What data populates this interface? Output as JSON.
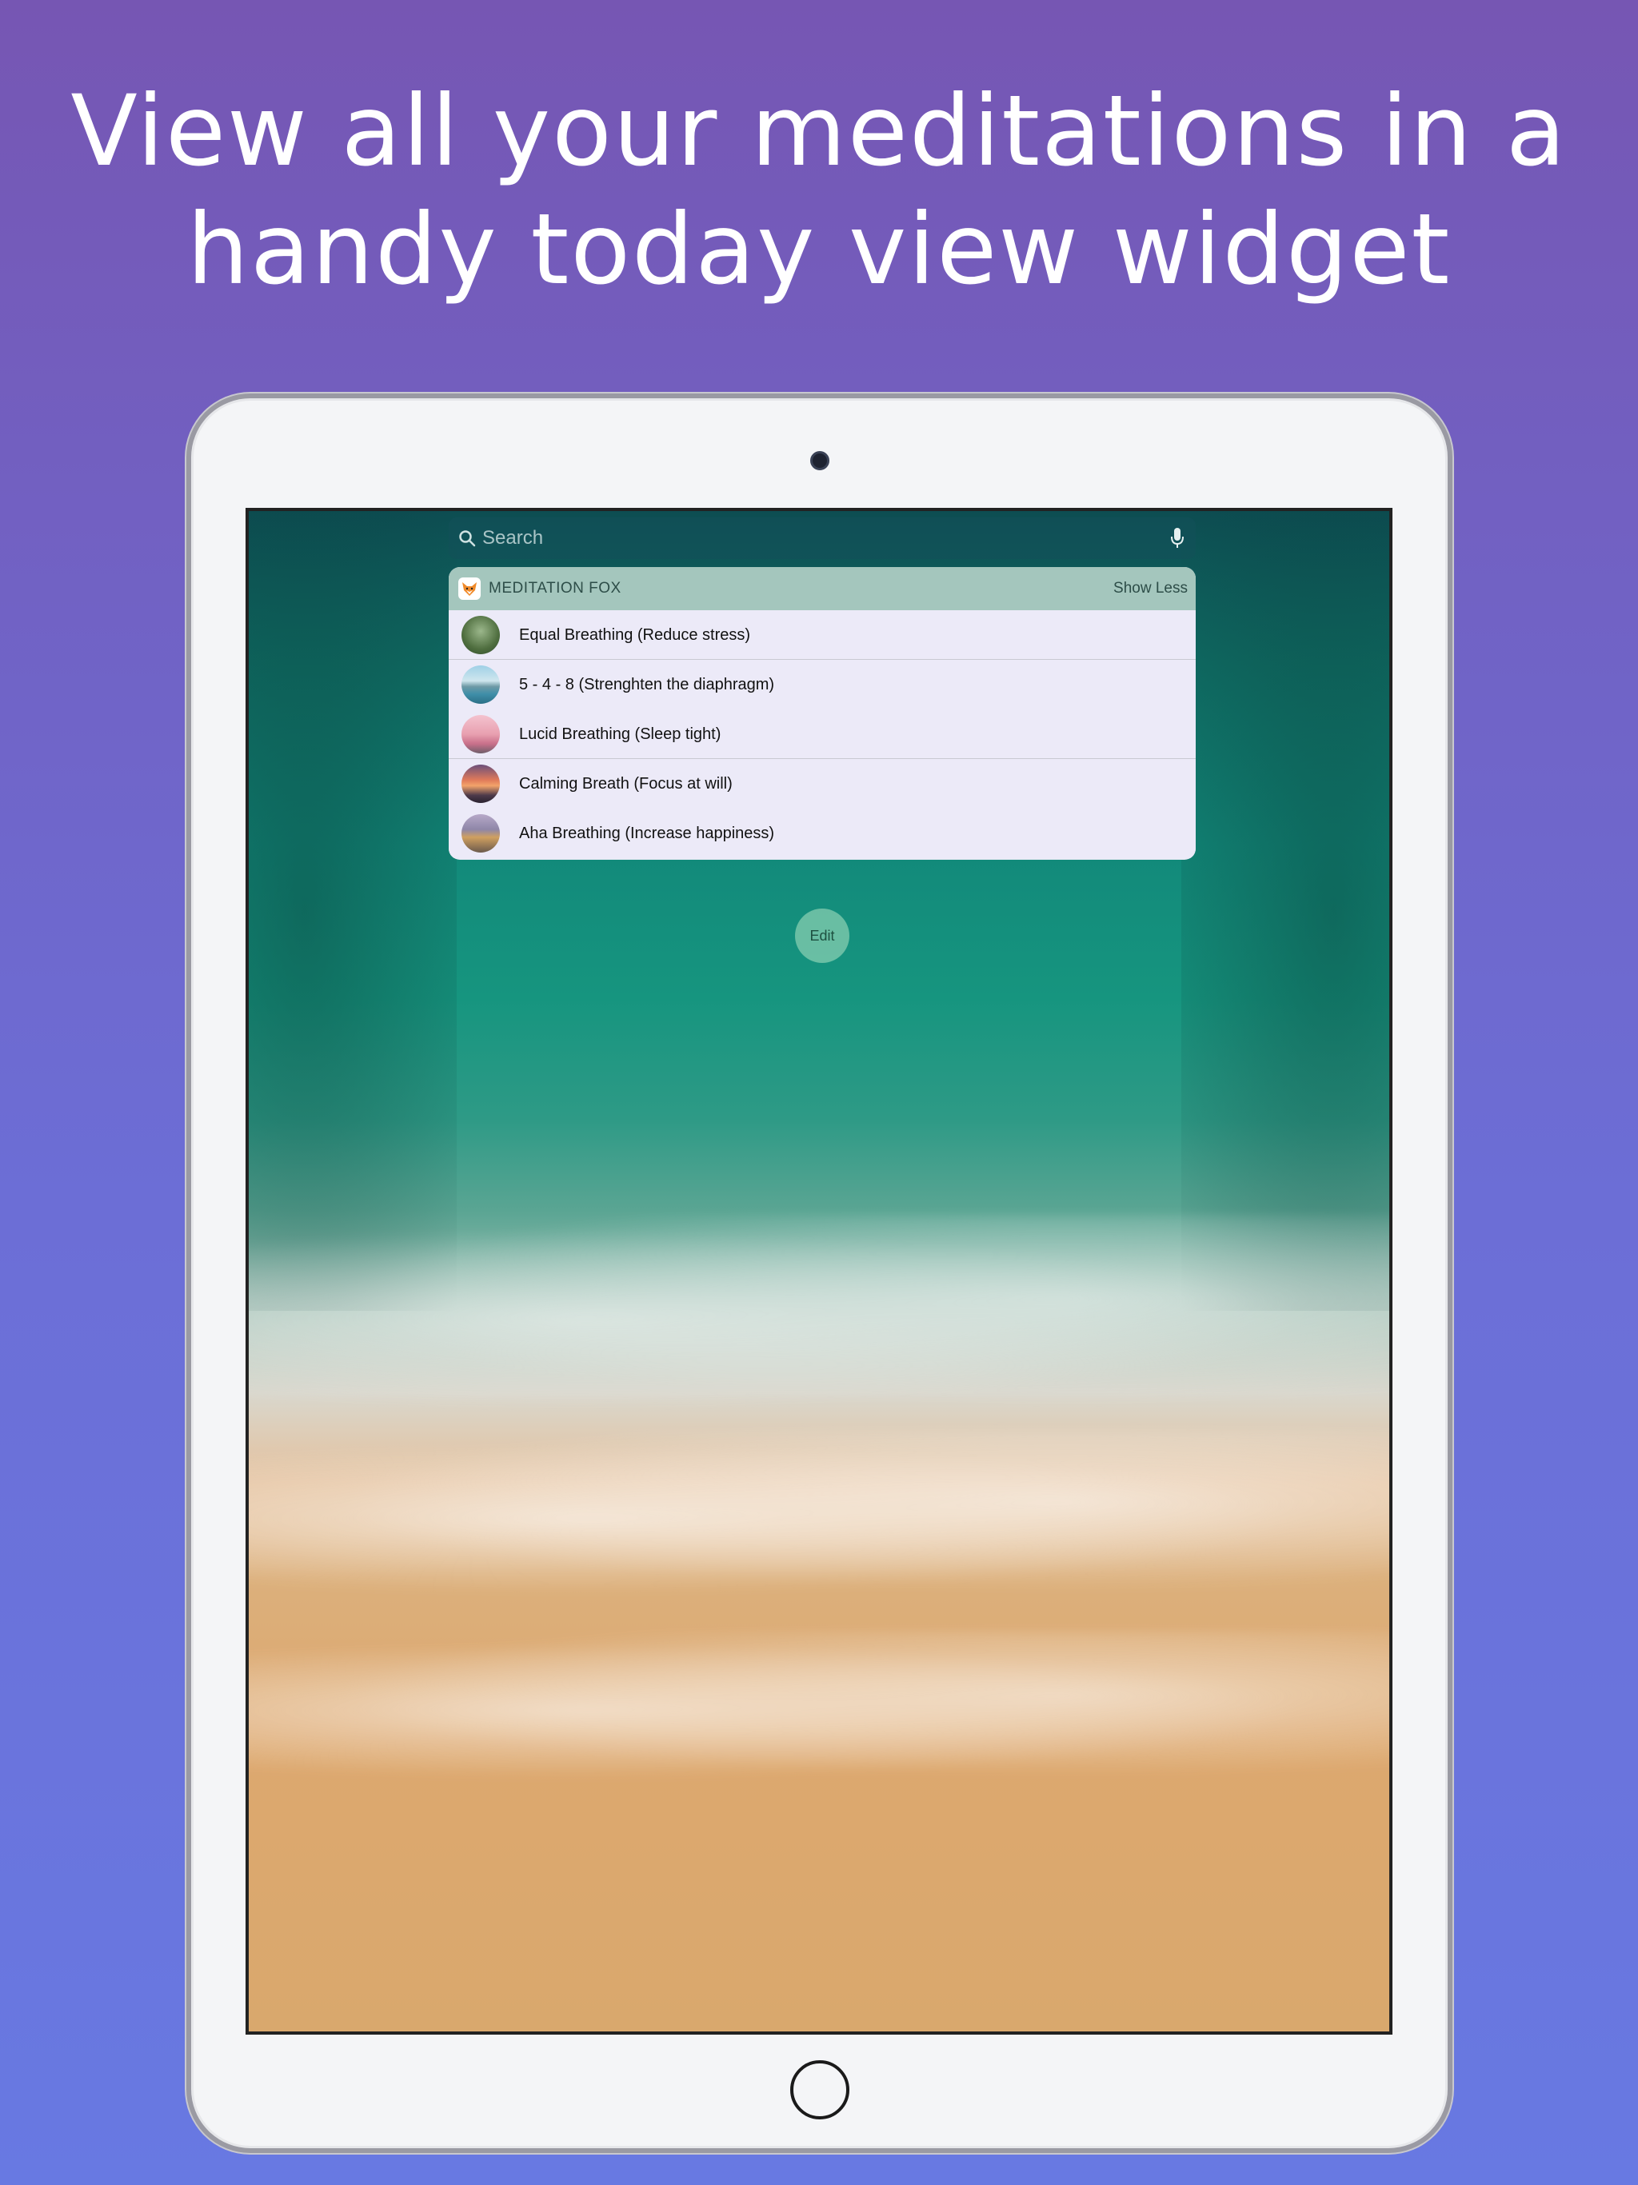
{
  "headline": {
    "line1": "View all your meditations in a",
    "line2": "handy today view widget"
  },
  "search": {
    "placeholder": "Search",
    "icon": "search-icon",
    "mic_icon": "microphone-icon"
  },
  "widget": {
    "app_name": "MEDITATION FOX",
    "app_icon": "fox-icon",
    "toggle_label": "Show Less",
    "items": [
      {
        "label": "Equal Breathing (Reduce stress)",
        "thumb": "forest"
      },
      {
        "label": "5 - 4 - 8 (Strenghten the diaphragm)",
        "thumb": "mountain-lake"
      },
      {
        "label": "Lucid Breathing (Sleep tight)",
        "thumb": "pink-sky"
      },
      {
        "label": "Calming Breath (Focus at will)",
        "thumb": "sunset"
      },
      {
        "label": "Aha Breathing (Increase happiness)",
        "thumb": "beach"
      }
    ]
  },
  "edit_label": "Edit",
  "colors": {
    "background_top": "#7656b3",
    "background_bottom": "#6879e2",
    "widget_header": "#a4c6bd",
    "widget_body": "#eaeaf6"
  }
}
